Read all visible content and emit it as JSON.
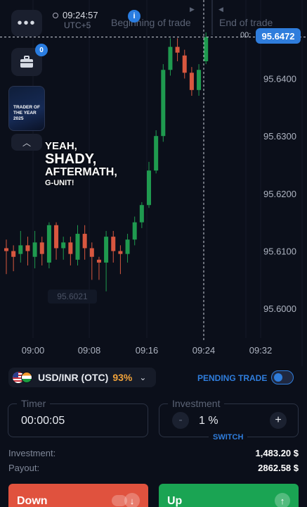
{
  "header": {
    "menu_label": "•••",
    "time": "09:24:57",
    "timezone": "UTC+5",
    "info_label": "i",
    "begin_label": "Beginning of trade",
    "end_label": "End of trade",
    "begin_flag": "▶",
    "end_flag": "◀"
  },
  "portfolio": {
    "badge": "0"
  },
  "promo": {
    "text": "TRADER OF THE YEAR 2025"
  },
  "collapse_label": "︿",
  "overlay_text": {
    "line1": "YEAH,",
    "line2": "SHADY,",
    "line3": "AFTERMATH,",
    "line4": "G-UNIT!"
  },
  "price_tag": {
    "prefix": "00:",
    "value": "95.6472"
  },
  "chart_data": {
    "type": "candlestick",
    "y_ticks": [
      "95.6400",
      "95.6300",
      "95.6200",
      "95.6100",
      "95.6000"
    ],
    "x_ticks": [
      "09:00",
      "09:08",
      "09:16",
      "09:24",
      "09:32"
    ],
    "low_marker": "95.6021",
    "current_price": 95.6472,
    "ylim": [
      95.5955,
      95.6512
    ],
    "candles": [
      {
        "o": 95.6105,
        "c": 95.61,
        "h": 95.612,
        "l": 95.606
      },
      {
        "o": 95.61,
        "c": 95.609,
        "h": 95.611,
        "l": 95.6065
      },
      {
        "o": 95.6095,
        "c": 95.611,
        "h": 95.6135,
        "l": 95.608
      },
      {
        "o": 95.611,
        "c": 95.61,
        "h": 95.6125,
        "l": 95.6075
      },
      {
        "o": 95.609,
        "c": 95.6115,
        "h": 95.6135,
        "l": 95.607
      },
      {
        "o": 95.6115,
        "c": 95.6095,
        "h": 95.6125,
        "l": 95.6075
      },
      {
        "o": 95.608,
        "c": 95.6145,
        "h": 95.615,
        "l": 95.607
      },
      {
        "o": 95.6145,
        "c": 95.6105,
        "h": 95.615,
        "l": 95.6085
      },
      {
        "o": 95.6105,
        "c": 95.6115,
        "h": 95.6125,
        "l": 95.6085
      },
      {
        "o": 95.6115,
        "c": 95.6095,
        "h": 95.6125,
        "l": 95.6075
      },
      {
        "o": 95.6085,
        "c": 95.613,
        "h": 95.6145,
        "l": 95.6075
      },
      {
        "o": 95.613,
        "c": 95.6105,
        "h": 95.6145,
        "l": 95.6085
      },
      {
        "o": 95.6105,
        "c": 95.609,
        "h": 95.6115,
        "l": 95.605
      },
      {
        "o": 95.6085,
        "c": 95.608,
        "h": 95.609,
        "l": 95.605
      },
      {
        "o": 95.608,
        "c": 95.6125,
        "h": 95.6135,
        "l": 95.603
      },
      {
        "o": 95.6125,
        "c": 95.61,
        "h": 95.6135,
        "l": 95.608
      },
      {
        "o": 95.61,
        "c": 95.6095,
        "h": 95.611,
        "l": 95.606
      },
      {
        "o": 95.6095,
        "c": 95.612,
        "h": 95.613,
        "l": 95.608
      },
      {
        "o": 95.612,
        "c": 95.615,
        "h": 95.616,
        "l": 95.611
      },
      {
        "o": 95.615,
        "c": 95.618,
        "h": 95.6185,
        "l": 95.614
      },
      {
        "o": 95.618,
        "c": 95.624,
        "h": 95.6255,
        "l": 95.6175
      },
      {
        "o": 95.624,
        "c": 95.63,
        "h": 95.631,
        "l": 95.6235
      },
      {
        "o": 95.63,
        "c": 95.6415,
        "h": 95.6425,
        "l": 95.629
      },
      {
        "o": 95.6415,
        "c": 95.6455,
        "h": 95.647,
        "l": 95.6405
      },
      {
        "o": 95.6455,
        "c": 95.6445,
        "h": 95.647,
        "l": 95.643
      },
      {
        "o": 95.644,
        "c": 95.641,
        "h": 95.645,
        "l": 95.64
      },
      {
        "o": 95.641,
        "c": 95.638,
        "h": 95.642,
        "l": 95.637
      },
      {
        "o": 95.638,
        "c": 95.6415,
        "h": 95.6425,
        "l": 95.637
      },
      {
        "o": 95.643,
        "c": 95.6472,
        "h": 95.648,
        "l": 95.6425
      }
    ]
  },
  "pair": {
    "name": "USD/INR (OTC)",
    "payout_pct": "93%",
    "chevron": "⌄"
  },
  "pending": {
    "label": "PENDING TRADE"
  },
  "timer": {
    "legend": "Timer",
    "value": "00:00:05"
  },
  "investment_field": {
    "legend": "Investment",
    "value": "1 %",
    "minus": "-",
    "plus": "+",
    "switch_label": "SWITCH"
  },
  "summary": {
    "investment_label": "Investment:",
    "investment_value": "1,483.20 $",
    "payout_label": "Payout:",
    "payout_value": "2862.58 $"
  },
  "buttons": {
    "down_label": "Down",
    "down_icon": "↓",
    "up_label": "Up",
    "up_icon": "↑"
  },
  "colors": {
    "bull": "#1f9a4f",
    "bear": "#d8573f",
    "accent": "#2f7ddc",
    "background": "#0b0f1a"
  }
}
